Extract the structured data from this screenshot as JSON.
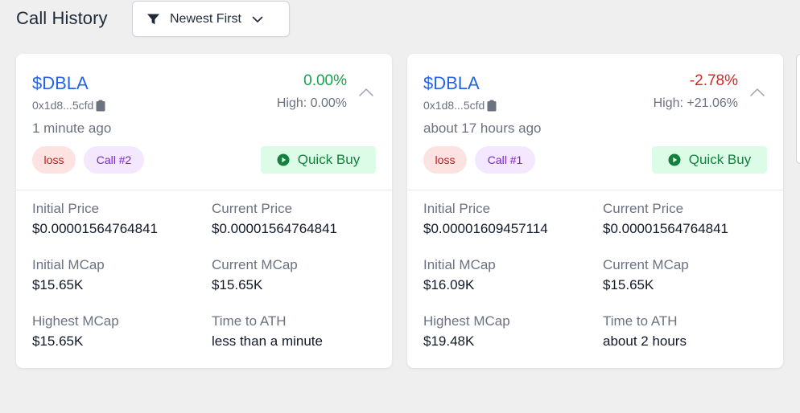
{
  "header": {
    "title": "Call History",
    "sort_label": "Newest First"
  },
  "colors": {
    "accent_blue": "#2563eb",
    "positive": "#16a34a",
    "negative": "#dc2626",
    "quick_buy_bg": "#dcfce7",
    "loss_tag_bg": "#fde2e2",
    "call_tag_bg": "#f3e8ff"
  },
  "icons": {
    "sort": "filter-icon",
    "dropdown": "chevron-down-icon",
    "copy": "clipboard-icon",
    "collapse": "chevron-up-icon",
    "quick_buy": "play-circle-icon"
  },
  "cards": [
    {
      "ticker": "$DBLA",
      "address": "0x1d8...5cfd",
      "time_ago": "1 minute ago",
      "change": "0.00%",
      "high": "High: 0.00%",
      "status_tag": "loss",
      "call_tag": "Call #2",
      "quick_buy_label": "Quick Buy",
      "stats": {
        "initial_price_label": "Initial Price",
        "initial_price": "$0.00001564764841",
        "current_price_label": "Current Price",
        "current_price": "$0.00001564764841",
        "initial_mcap_label": "Initial MCap",
        "initial_mcap": "$15.65K",
        "current_mcap_label": "Current MCap",
        "current_mcap": "$15.65K",
        "highest_mcap_label": "Highest MCap",
        "highest_mcap": "$15.65K",
        "time_to_ath_label": "Time to ATH",
        "time_to_ath": "less than a minute"
      }
    },
    {
      "ticker": "$DBLA",
      "address": "0x1d8...5cfd",
      "time_ago": "about 17 hours ago",
      "change": "-2.78%",
      "high": "High: +21.06%",
      "status_tag": "loss",
      "call_tag": "Call #1",
      "quick_buy_label": "Quick Buy",
      "stats": {
        "initial_price_label": "Initial Price",
        "initial_price": "$0.00001609457114",
        "current_price_label": "Current Price",
        "current_price": "$0.00001564764841",
        "initial_mcap_label": "Initial MCap",
        "initial_mcap": "$16.09K",
        "current_mcap_label": "Current MCap",
        "current_mcap": "$15.65K",
        "highest_mcap_label": "Highest MCap",
        "highest_mcap": "$19.48K",
        "time_to_ath_label": "Time to ATH",
        "time_to_ath": "about 2 hours"
      }
    }
  ]
}
